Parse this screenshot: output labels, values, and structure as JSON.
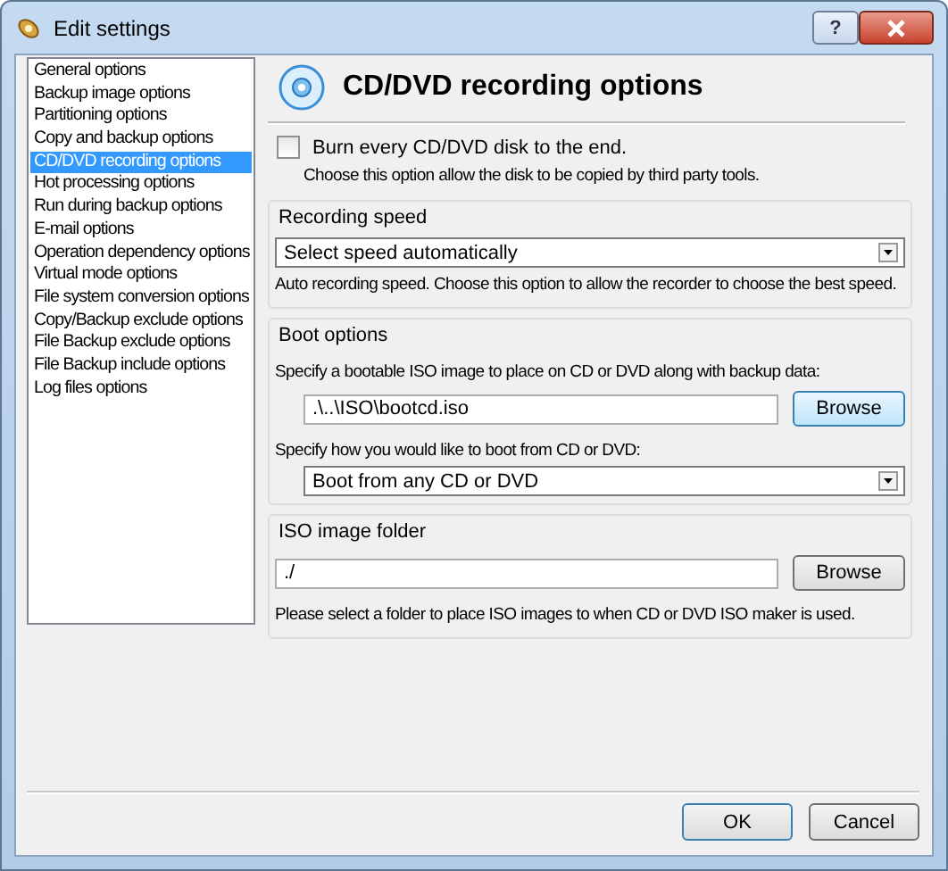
{
  "window": {
    "title": "Edit settings",
    "help_button": "?"
  },
  "sidebar": {
    "items": [
      {
        "label": "General options",
        "selected": false
      },
      {
        "label": "Backup image options",
        "selected": false
      },
      {
        "label": "Partitioning options",
        "selected": false
      },
      {
        "label": "Copy and backup options",
        "selected": false
      },
      {
        "label": "CD/DVD recording options",
        "selected": true
      },
      {
        "label": "Hot processing options",
        "selected": false
      },
      {
        "label": "Run during backup options",
        "selected": false
      },
      {
        "label": "E-mail options",
        "selected": false
      },
      {
        "label": "Operation dependency options",
        "selected": false
      },
      {
        "label": "Virtual mode options",
        "selected": false
      },
      {
        "label": "File system conversion options",
        "selected": false
      },
      {
        "label": "Copy/Backup exclude options",
        "selected": false
      },
      {
        "label": "File Backup exclude options",
        "selected": false
      },
      {
        "label": "File Backup include options",
        "selected": false
      },
      {
        "label": "Log files options",
        "selected": false
      }
    ]
  },
  "page": {
    "title": "CD/DVD recording options",
    "burn_option": {
      "label": "Burn every CD/DVD disk to the end.",
      "checked": false,
      "description": "Choose this option allow the disk to be copied by third party tools."
    },
    "recording_speed": {
      "title": "Recording speed",
      "value": "Select speed automatically",
      "description": "Auto recording speed. Choose this option to allow the recorder to choose the best speed."
    },
    "boot_options": {
      "title": "Boot options",
      "iso_label": "Specify a bootable ISO image to place on CD or DVD along with backup data:",
      "iso_value": ".\\..\\ISO\\bootcd.iso",
      "browse": "Browse",
      "boot_label": "Specify how you would like to boot from CD or DVD:",
      "boot_value": "Boot from any CD or DVD"
    },
    "iso_folder": {
      "title": "ISO image folder",
      "value": "./",
      "browse": "Browse",
      "description": "Please select a folder to place ISO images to when CD or DVD ISO maker is used."
    }
  },
  "buttons": [
    {
      "label": "OK",
      "kind": "default"
    },
    {
      "label": "Cancel",
      "kind": "normal"
    }
  ]
}
